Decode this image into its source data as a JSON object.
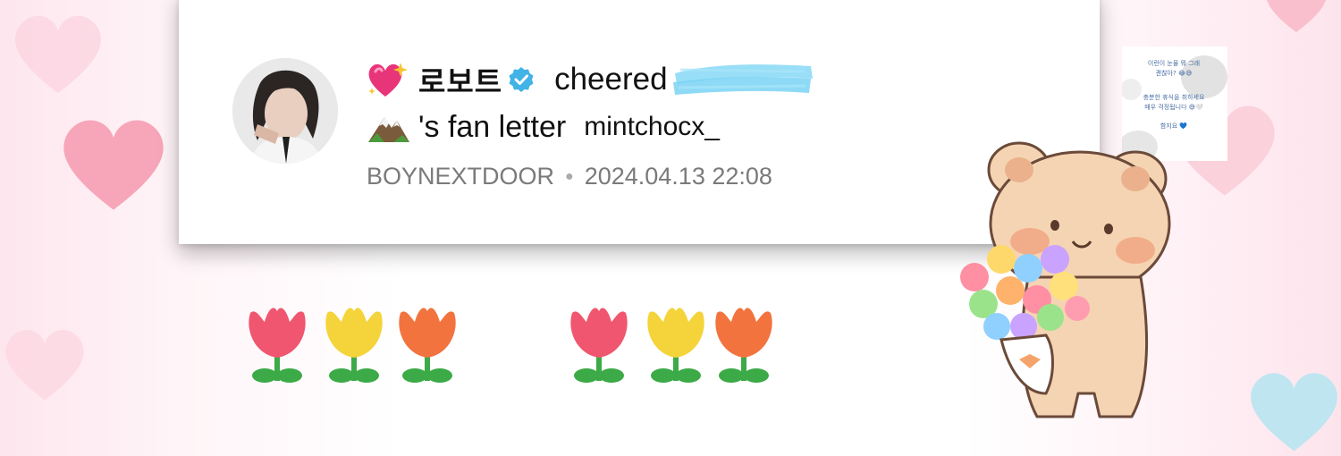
{
  "post": {
    "user_name": "로보트",
    "action": "cheered",
    "possessive": "'s fan letter",
    "author": "mintchocx_",
    "group": "BOYNEXTDOOR",
    "timestamp": "2024.04.13 22:08"
  },
  "thumbnail": {
    "line1": "이런이 눈물 뭐 그래",
    "line2": "괜찮아? 😂😅",
    "line3": "충분한 휴식을 취하세요",
    "line4": "매우 걱정됩니다 😅🤍",
    "line5": "함지요 💙"
  },
  "colors": {
    "verified": "#41b3e6",
    "meta_text": "#7a7a7a",
    "scribble": "#7ad3f4",
    "tulip_red": "#f0566f",
    "tulip_yellow": "#f4d43a",
    "tulip_orange": "#f2733e",
    "stem": "#3caa47"
  },
  "icons": {
    "sparkle_heart": "sparkling-heart-icon",
    "verified": "verified-badge-icon",
    "mountain": "mountain-emoji-icon"
  }
}
